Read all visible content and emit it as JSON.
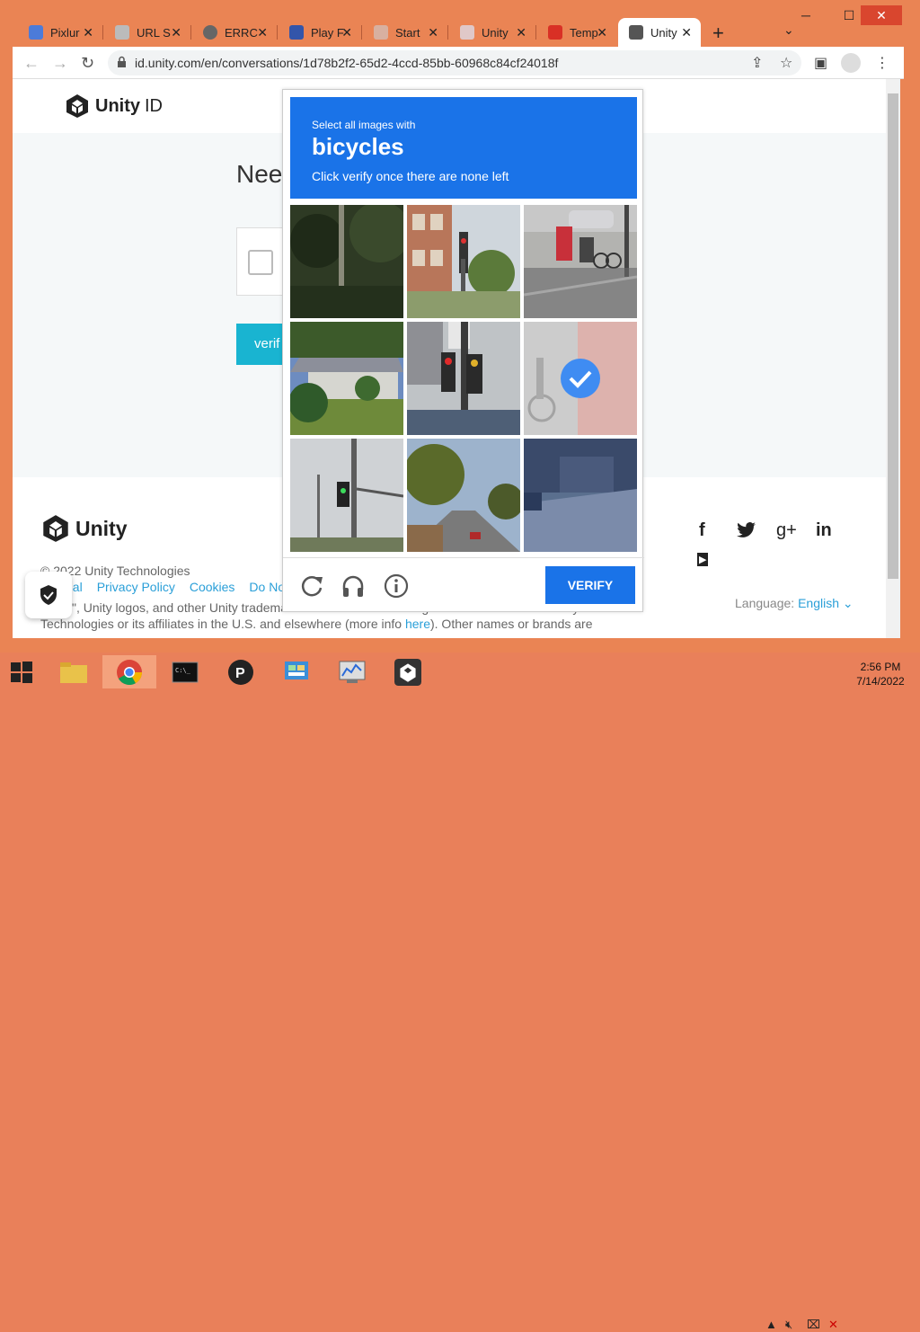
{
  "browser": {
    "tabs": [
      {
        "title": "Pixlur",
        "color": "#4c7bd9"
      },
      {
        "title": "URL S",
        "color": "#999999"
      },
      {
        "title": "ERRC",
        "color": "#666666"
      },
      {
        "title": "Play F",
        "color": "#3355aa"
      },
      {
        "title": "Start",
        "color": "#c0a0a0"
      },
      {
        "title": "Unity",
        "color": "#d0b8b8"
      },
      {
        "title": "Temp",
        "color": "#d93025"
      },
      {
        "title": "Unity",
        "color": "#555555"
      }
    ],
    "new_tab": "+",
    "url": "id.unity.com/en/conversations/1d78b2f2-65d2-4ccd-85bb-60968c84cf24018f"
  },
  "page": {
    "brand_bold": "Unity",
    "brand_rest": "ID",
    "heading": "Nee",
    "verify_btn": "verif",
    "footer_brand": "Unity",
    "copyright": "© 2022 Unity Technologies",
    "links": [
      "gal",
      "Privacy Policy",
      "Cookies",
      "Do Not"
    ],
    "legal_line1": "y\", Unity logos, and other Unity trademarks are trademarks or registered trademarks of Unity",
    "legal_line2a": "Technologies or its affiliates in the U.S. and elsewhere (more info ",
    "legal_here": "here",
    "legal_line2b": "). Other names or brands are",
    "language_label": "Language:",
    "language_value": "English"
  },
  "captcha": {
    "prompt_small": "Select all images with",
    "prompt_target": "bicycles",
    "prompt_hint": "Click verify once there are none left",
    "verify_label": "VERIFY",
    "selected_tile": 5
  },
  "taskbar": {
    "time": "2:56 PM",
    "date": "7/14/2022"
  }
}
